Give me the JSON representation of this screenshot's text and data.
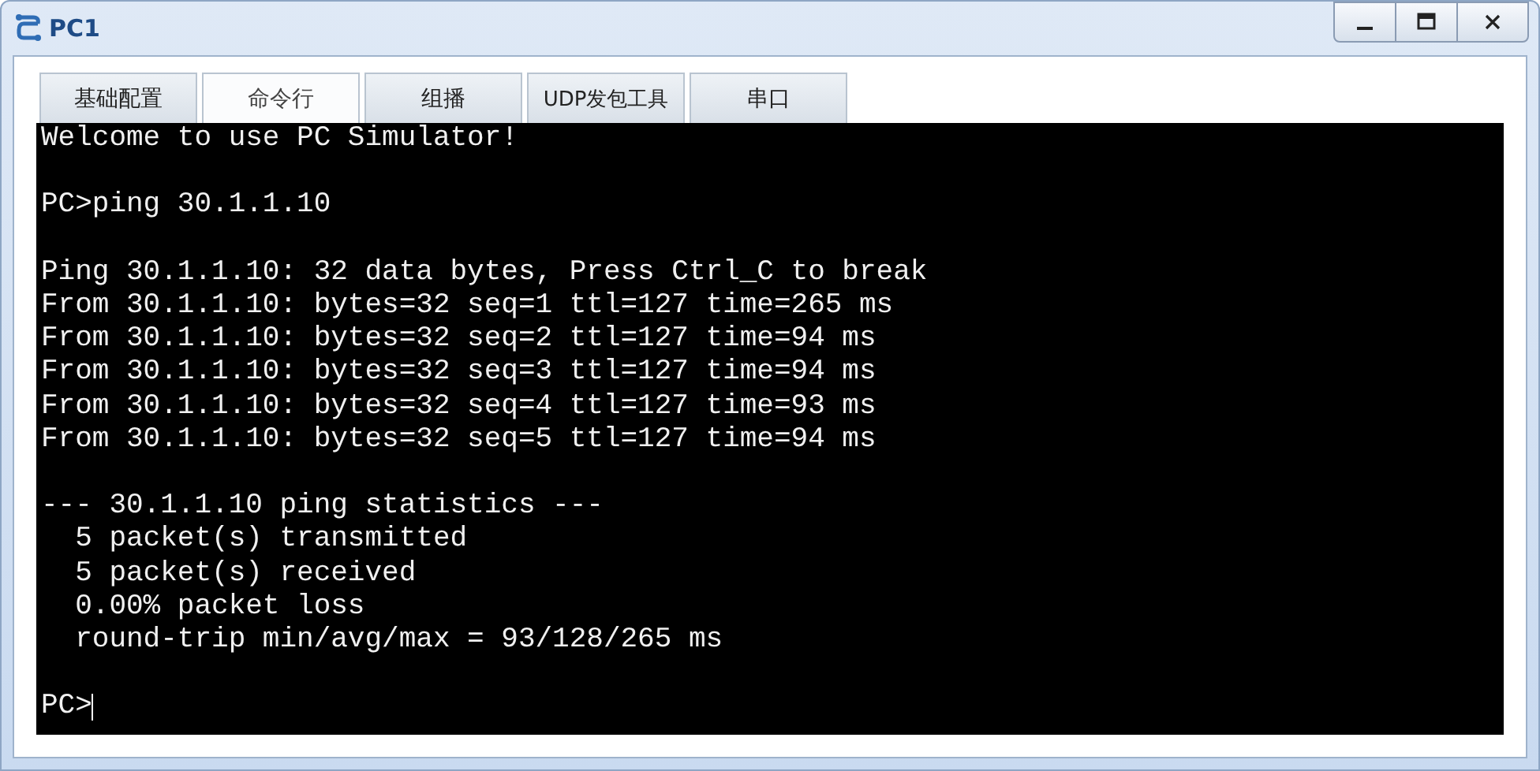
{
  "window": {
    "title": "PC1"
  },
  "tabs": [
    {
      "label": "基础配置",
      "selected": false
    },
    {
      "label": "命令行",
      "selected": true
    },
    {
      "label": "组播",
      "selected": false
    },
    {
      "label": "UDP发包工具",
      "selected": false
    },
    {
      "label": "串口",
      "selected": false
    }
  ],
  "terminal": {
    "blocks": [
      [
        "Welcome to use PC Simulator!"
      ],
      [
        "PC>ping 30.1.1.10"
      ],
      [
        "Ping 30.1.1.10: 32 data bytes, Press Ctrl_C to break",
        "From 30.1.1.10: bytes=32 seq=1 ttl=127 time=265 ms",
        "From 30.1.1.10: bytes=32 seq=2 ttl=127 time=94 ms",
        "From 30.1.1.10: bytes=32 seq=3 ttl=127 time=94 ms",
        "From 30.1.1.10: bytes=32 seq=4 ttl=127 time=93 ms",
        "From 30.1.1.10: bytes=32 seq=5 ttl=127 time=94 ms"
      ],
      [
        "--- 30.1.1.10 ping statistics ---",
        "  5 packet(s) transmitted",
        "  5 packet(s) received",
        "  0.00% packet loss",
        "  round-trip min/avg/max = 93/128/265 ms"
      ]
    ],
    "prompt": "PC>"
  }
}
